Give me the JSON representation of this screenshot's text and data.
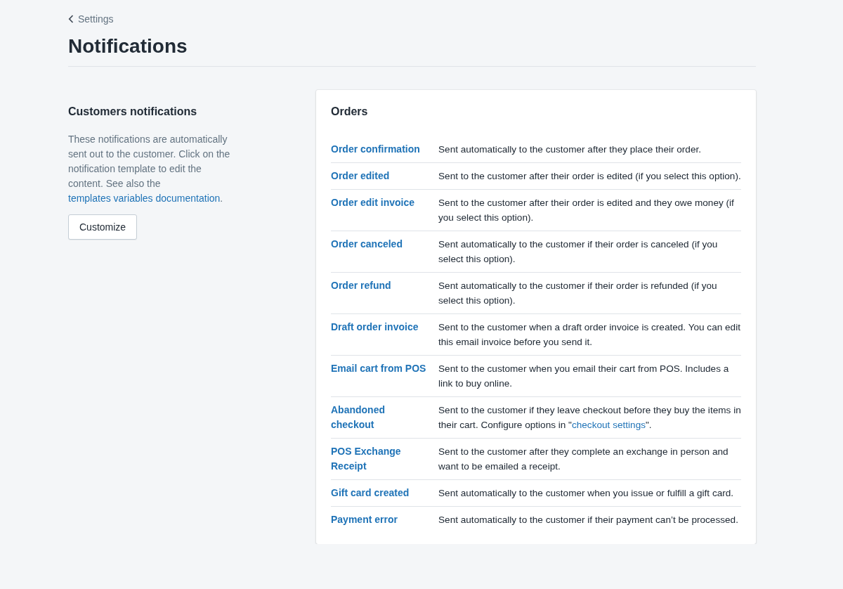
{
  "breadcrumb": {
    "label": "Settings"
  },
  "page_title": "Notifications",
  "section": {
    "title": "Customers notifications",
    "description": {
      "text": "These notifications are automatically sent out to the customer. Click on the notification template to edit the content. See also the ",
      "link": "templates variables documentation",
      "after": "."
    },
    "button": "Customize"
  },
  "card": {
    "title": "Orders",
    "rows": [
      {
        "name": "Order confirmation",
        "description": {
          "text": "Sent automatically to the customer after they place their order."
        }
      },
      {
        "name": "Order edited",
        "description": {
          "text": "Sent to the customer after their order is edited (if you select this option)."
        }
      },
      {
        "name": "Order edit invoice",
        "description": {
          "text": "Sent to the customer after their order is edited and they owe money (if you select this option)."
        }
      },
      {
        "name": "Order canceled",
        "description": {
          "text": "Sent automatically to the customer if their order is canceled (if you select this option)."
        }
      },
      {
        "name": "Order refund",
        "description": {
          "text": "Sent automatically to the customer if their order is refunded (if you select this option)."
        }
      },
      {
        "name": "Draft order invoice",
        "description": {
          "text": "Sent to the customer when a draft order invoice is created. You can edit this email invoice before you send it."
        }
      },
      {
        "name": "Email cart from POS",
        "description": {
          "text": "Sent to the customer when you email their cart from POS. Includes a link to buy online."
        }
      },
      {
        "name": "Abandoned checkout",
        "description": {
          "text": "Sent to the customer if they leave checkout before they buy the items in their cart. Configure options in \"",
          "link": "checkout settings",
          "after": "\"."
        }
      },
      {
        "name": "POS Exchange Receipt",
        "description": {
          "text": "Sent to the customer after they complete an exchange in person and want to be emailed a receipt."
        }
      },
      {
        "name": "Gift card created",
        "description": {
          "text": "Sent automatically to the customer when you issue or fulfill a gift card."
        }
      },
      {
        "name": "Payment error",
        "description": {
          "text": "Sent automatically to the customer if their payment can’t be processed."
        }
      }
    ]
  }
}
